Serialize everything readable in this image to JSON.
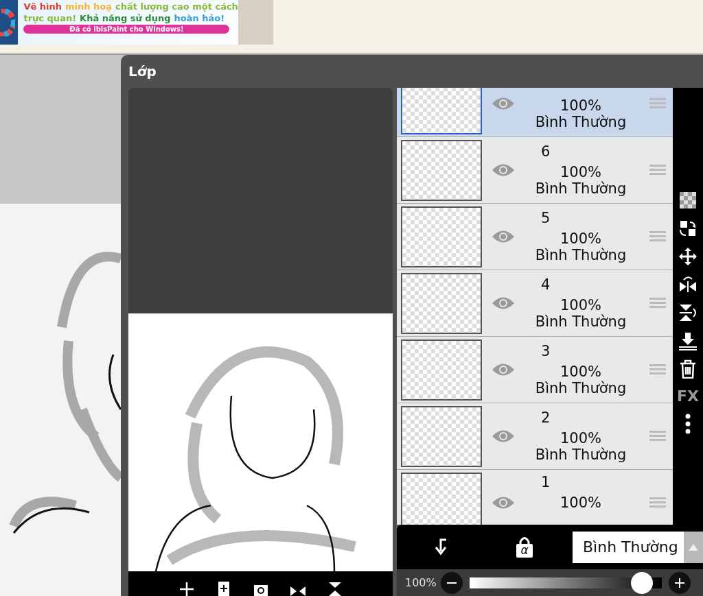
{
  "ad_banner": {
    "lines": [
      [
        {
          "text": "Vẽ hình",
          "color": "#d8432c"
        },
        {
          "text": "minh hoạ",
          "color": "#f2b53a"
        },
        {
          "text": "chất lượng cao một cách",
          "color": "#86b83c"
        }
      ],
      [
        {
          "text": "trực quan!",
          "color": "#86b83c"
        },
        {
          "text": "Khả năng sử dụng",
          "color": "#2e8b3a"
        },
        {
          "text": "hoàn hảo!",
          "color": "#3a9fd6"
        }
      ]
    ],
    "button": "Đã có ibisPaint cho Windows!"
  },
  "layer_panel": {
    "title": "Lớp",
    "layers": [
      {
        "opacity": "100%",
        "blend": "Bình Thường",
        "selected": true,
        "visible": true
      },
      {
        "name": "6",
        "opacity": "100%",
        "blend": "Bình Thường",
        "selected": false,
        "visible": true
      },
      {
        "name": "5",
        "opacity": "100%",
        "blend": "Bình Thường",
        "selected": false,
        "visible": true
      },
      {
        "name": "4",
        "opacity": "100%",
        "blend": "Bình Thường",
        "selected": false,
        "visible": true
      },
      {
        "name": "3",
        "opacity": "100%",
        "blend": "Bình Thường",
        "selected": false,
        "visible": true
      },
      {
        "name": "2",
        "opacity": "100%",
        "blend": "Bình Thường",
        "selected": false,
        "visible": true
      },
      {
        "name": "1",
        "opacity": "100%",
        "selected": false,
        "visible": true
      }
    ],
    "fx_label": "FX",
    "alpha_lock": "α",
    "blend_mode": "Bình Thường",
    "opacity": {
      "reading": "100%",
      "level": 0.95
    }
  }
}
